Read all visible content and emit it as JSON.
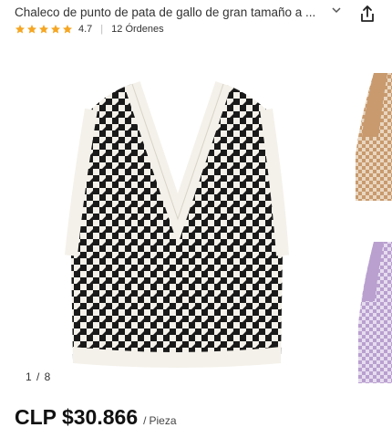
{
  "product": {
    "title": "Chaleco de punto de pata de gallo de gran tamaño a ...",
    "rating": "4.7",
    "orders": "12 Órdenes",
    "stars_filled": 5
  },
  "gallery": {
    "page_indicator": "1 / 8"
  },
  "price": {
    "amount": "CLP $30.866",
    "separator": "/",
    "unit": "Pieza"
  },
  "colors": {
    "star": "#f5a623",
    "thumb_brown": "#c89a6e",
    "thumb_lilac": "#b9a0cf"
  },
  "icons": {
    "share": "share-icon",
    "dropdown": "chevron-down-icon",
    "star": "star-icon"
  }
}
